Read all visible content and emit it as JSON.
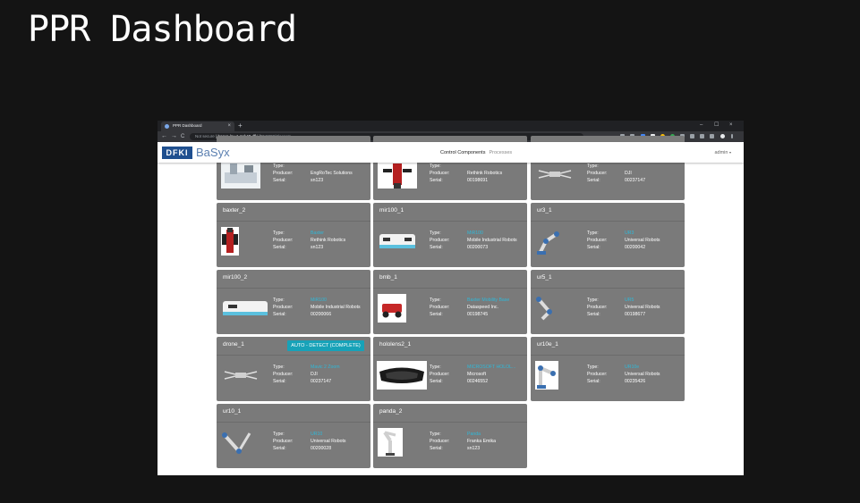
{
  "slide": {
    "title": "PPR Dashboard"
  },
  "browser": {
    "tab_title": "PPR Dashboard",
    "tab_close": "×",
    "new_tab": "+",
    "window_controls": [
      "–",
      "☐",
      "×"
    ],
    "nav": {
      "back": "←",
      "forward": "→",
      "reload": "C"
    },
    "not_secure": "Not secure",
    "url_host": "basys-lnv-1.mrk40.dfki.lan",
    "url_path": ":8080/#/assets"
  },
  "app": {
    "logo_dfki": "DFKI",
    "logo_basyx": "BaSyx",
    "nav_links": [
      "Control Components",
      "Processes"
    ],
    "user": "admin",
    "caret": "▾"
  },
  "labels": {
    "type": "Type:",
    "producer": "Producer:",
    "serial": "Serial:"
  },
  "assets": [
    {
      "name": "",
      "type": "",
      "producer": "EngRoTec Solutions",
      "serial": "sn123"
    },
    {
      "name": "",
      "type": "",
      "producer": "Rethink Robotics",
      "serial": "00198691"
    },
    {
      "name": "",
      "type": "",
      "producer": "DJI",
      "serial": "00237147"
    },
    {
      "name": "baxter_2",
      "type": "Baxter",
      "producer": "Rethink Robotics",
      "serial": "sn123"
    },
    {
      "name": "mir100_1",
      "type": "MiR100",
      "producer": "Mobile Industrial Robots",
      "serial": "00200073"
    },
    {
      "name": "ur3_1",
      "type": "UR3",
      "producer": "Universal Robots",
      "serial": "00200042"
    },
    {
      "name": "mir100_2",
      "type": "MiR100",
      "producer": "Mobile Industrial Robots",
      "serial": "00200066"
    },
    {
      "name": "bmb_1",
      "type": "Baxter Mobility Base",
      "producer": "Dataspeed Inc.",
      "serial": "00198745"
    },
    {
      "name": "ur5_1",
      "type": "UR5",
      "producer": "Universal Robots",
      "serial": "00198677"
    },
    {
      "name": "drone_1",
      "type": "Mavic 2 Zoom",
      "producer": "DJI",
      "serial": "00237147",
      "button": "AUTO - DETECT (COMPLETE)"
    },
    {
      "name": "hololens2_1",
      "type": "MICROSOFT HOLOL...",
      "producer": "Microsoft",
      "serial": "00246552"
    },
    {
      "name": "ur10e_1",
      "type": "UR10e",
      "producer": "Universal Robots",
      "serial": "00235426"
    },
    {
      "name": "ur10_1",
      "type": "UR10",
      "producer": "Universal Robots",
      "serial": "00200028"
    },
    {
      "name": "panda_2",
      "type": "Panda",
      "producer": "Franka Emika",
      "serial": "sn123"
    }
  ],
  "colors": {
    "accent": "#17a2b8",
    "type_text": "#2fb8d8",
    "card_bg": "#7a7a7a",
    "page_bg": "#141414"
  }
}
